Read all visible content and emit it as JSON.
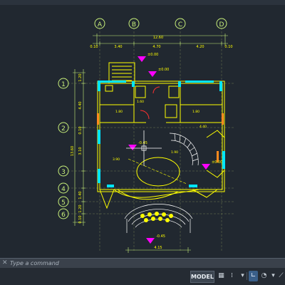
{
  "drawing": {
    "grid_columns": [
      "A",
      "B",
      "C",
      "D"
    ],
    "grid_rows": [
      "1",
      "2",
      "3",
      "4",
      "5",
      "6"
    ],
    "dim_top_total": "12.60",
    "dim_top_parts": [
      "0.10",
      "3.40",
      "4.70",
      "4.20",
      "0.10"
    ],
    "dim_left_total": "13.60",
    "dim_left_parts": [
      "1.20",
      "4.40",
      "0.10",
      "3.10",
      "1.40",
      "1.20",
      "0.10"
    ],
    "dim_bottom": "4.15",
    "level_marks": [
      "±0.00",
      "±0.00",
      "-0.45",
      "±0.00",
      "-0.45"
    ],
    "room_dims": [
      "1.80",
      "1.80",
      "1.60",
      "4.40",
      "3.90",
      "1.90"
    ],
    "colors": {
      "background": "#212830",
      "walls": "#ffff00",
      "axis": "#c8f07a",
      "fill": "#00e5ff",
      "accent": "#ff00ff",
      "red": "#ff3030"
    }
  },
  "command_line": {
    "placeholder": "Type a command"
  },
  "status_bar": {
    "model_label": "MODEL",
    "icons": [
      "grid-icon",
      "snap-icon",
      "ortho-icon",
      "polar-icon",
      "osnap-icon",
      "settings-icon"
    ]
  }
}
